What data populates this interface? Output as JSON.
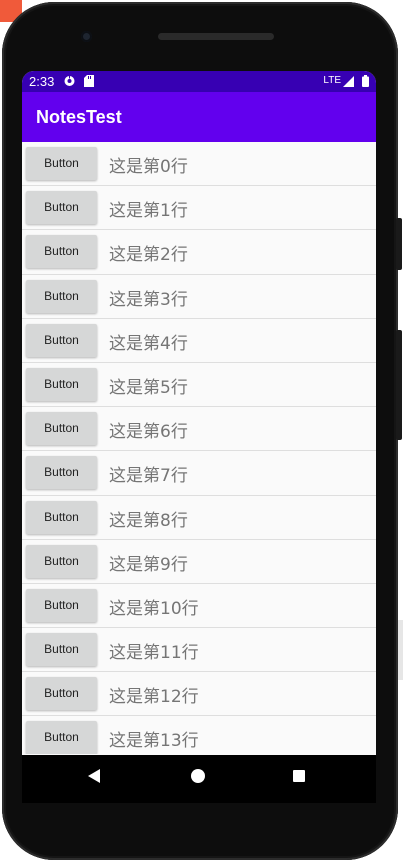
{
  "status_bar": {
    "time": "2:33",
    "network": "LTE"
  },
  "app_bar": {
    "title": "NotesTest"
  },
  "list": {
    "rows": [
      {
        "button": "Button",
        "text": "这是第0行"
      },
      {
        "button": "Button",
        "text": "这是第1行"
      },
      {
        "button": "Button",
        "text": "这是第2行"
      },
      {
        "button": "Button",
        "text": "这是第3行"
      },
      {
        "button": "Button",
        "text": "这是第4行"
      },
      {
        "button": "Button",
        "text": "这是第5行"
      },
      {
        "button": "Button",
        "text": "这是第6行"
      },
      {
        "button": "Button",
        "text": "这是第7行"
      },
      {
        "button": "Button",
        "text": "这是第8行"
      },
      {
        "button": "Button",
        "text": "这是第9行"
      },
      {
        "button": "Button",
        "text": "这是第10行"
      },
      {
        "button": "Button",
        "text": "这是第11行"
      },
      {
        "button": "Button",
        "text": "这是第12行"
      },
      {
        "button": "Button",
        "text": "这是第13行"
      }
    ]
  },
  "colors": {
    "status_bar": "#3700b3",
    "app_bar": "#6200ee",
    "list_background": "#fafafa",
    "button": "#d6d7d7",
    "row_text": "#757575"
  },
  "icons": {
    "status_left": [
      "data-saver-icon",
      "sd-card-icon"
    ],
    "status_right": [
      "signal-icon",
      "battery-icon"
    ],
    "navigation": [
      "back-icon",
      "home-icon",
      "recents-icon"
    ]
  }
}
